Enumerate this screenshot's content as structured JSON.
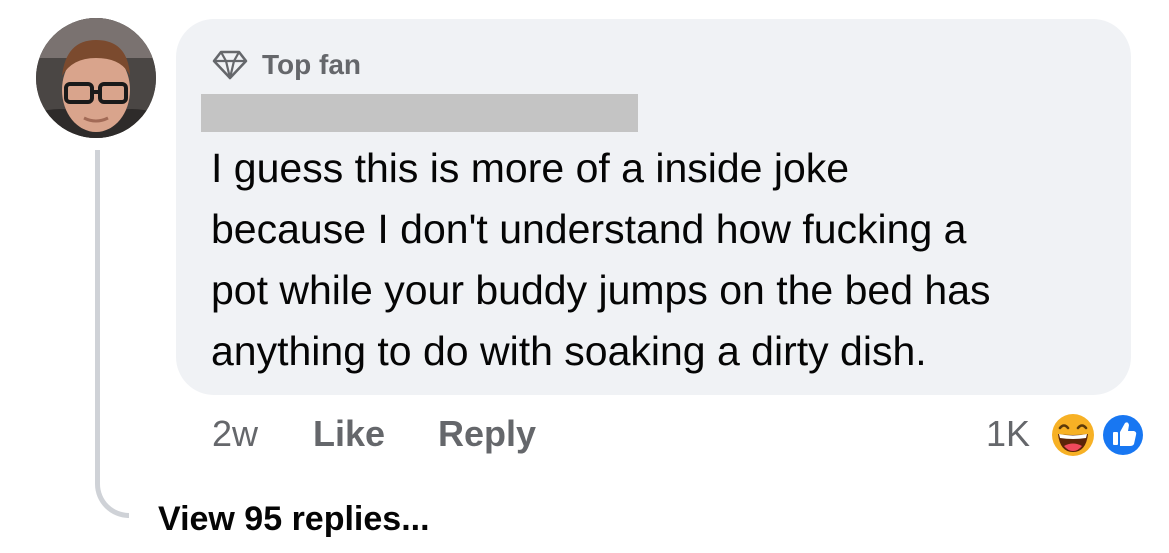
{
  "comment": {
    "badge_label": "Top fan",
    "text": "I guess this is more of a inside joke\nbecause I don't understand how fucking a\npot while your buddy jumps on the bed has\nanything to do with soaking a dirty dish.",
    "timestamp": "2w",
    "like_label": "Like",
    "reply_label": "Reply",
    "reaction_count": "1K",
    "reactions": [
      "laugh-reaction-icon",
      "like-reaction-icon"
    ],
    "view_replies_label": "View 95 replies..."
  },
  "colors": {
    "bubble": "#f0f2f5",
    "secondary_text": "#65676b",
    "primary_text": "#050505",
    "like_blue": "#1877f2",
    "laugh_yellow": "#f7b125"
  }
}
